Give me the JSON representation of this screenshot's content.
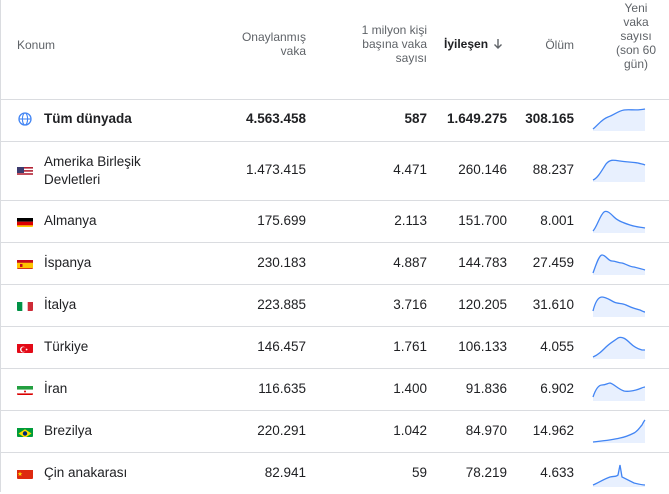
{
  "header": {
    "location": "Konum",
    "confirmed": "Onaylanmış vaka",
    "per_million": "1 milyon kişi başına vaka sayısı",
    "recovered": "İyileşen",
    "deaths": "Ölüm",
    "new_cases": "Yeni vaka sayısı (son 60 gün)",
    "sort_icon": "arrow-down-icon"
  },
  "rows": [
    {
      "name": "Tüm dünyada",
      "confirmed": "4.563.458",
      "per_million": "587",
      "recovered": "1.649.275",
      "deaths": "308.165",
      "icon": "globe-icon"
    },
    {
      "name": "Amerika Birleşik Devletleri",
      "confirmed": "1.473.415",
      "per_million": "4.471",
      "recovered": "260.146",
      "deaths": "88.237",
      "icon": "us-flag-icon"
    },
    {
      "name": "Almanya",
      "confirmed": "175.699",
      "per_million": "2.113",
      "recovered": "151.700",
      "deaths": "8.001",
      "icon": "germany-flag-icon"
    },
    {
      "name": "İspanya",
      "confirmed": "230.183",
      "per_million": "4.887",
      "recovered": "144.783",
      "deaths": "27.459",
      "icon": "spain-flag-icon"
    },
    {
      "name": "İtalya",
      "confirmed": "223.885",
      "per_million": "3.716",
      "recovered": "120.205",
      "deaths": "31.610",
      "icon": "italy-flag-icon"
    },
    {
      "name": "Türkiye",
      "confirmed": "146.457",
      "per_million": "1.761",
      "recovered": "106.133",
      "deaths": "4.055",
      "icon": "turkey-flag-icon"
    },
    {
      "name": "İran",
      "confirmed": "116.635",
      "per_million": "1.400",
      "recovered": "91.836",
      "deaths": "6.902",
      "icon": "iran-flag-icon"
    },
    {
      "name": "Brezilya",
      "confirmed": "220.291",
      "per_million": "1.042",
      "recovered": "84.970",
      "deaths": "14.962",
      "icon": "brazil-flag-icon"
    },
    {
      "name": "Çin anakarası",
      "confirmed": "82.941",
      "per_million": "59",
      "recovered": "78.219",
      "deaths": "4.633",
      "icon": "china-flag-icon"
    }
  ],
  "colors": {
    "spark_line": "#4285f4",
    "spark_fill": "#e8f0fe",
    "border": "#dadce0",
    "header_text": "#5f6368"
  }
}
